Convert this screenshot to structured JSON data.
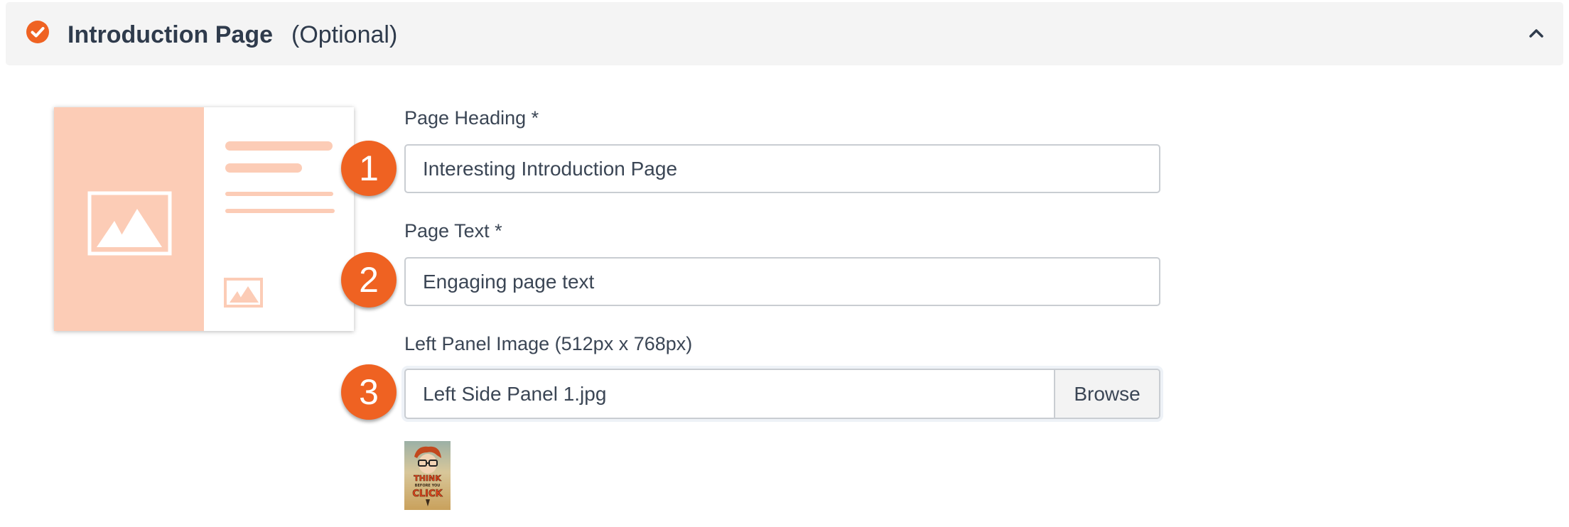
{
  "header": {
    "title": "Introduction Page",
    "optional_label": "(Optional)",
    "check_icon": "check-circle-icon",
    "collapse_icon": "chevron-up-icon",
    "accent_color": "#ef6222"
  },
  "form": {
    "page_heading": {
      "label": "Page Heading *",
      "value": "Interesting Introduction Page",
      "step": "1"
    },
    "page_text": {
      "label": "Page Text *",
      "value": "Engaging page text",
      "step": "2"
    },
    "left_panel_image": {
      "label": "Left Panel Image (512px x 768px)",
      "file_name": "Left Side Panel 1.jpg",
      "browse_label": "Browse",
      "step": "3"
    },
    "thumbnail": {
      "line1": "THINK",
      "line2": "BEFORE YOU",
      "line3": "CLICK"
    }
  }
}
